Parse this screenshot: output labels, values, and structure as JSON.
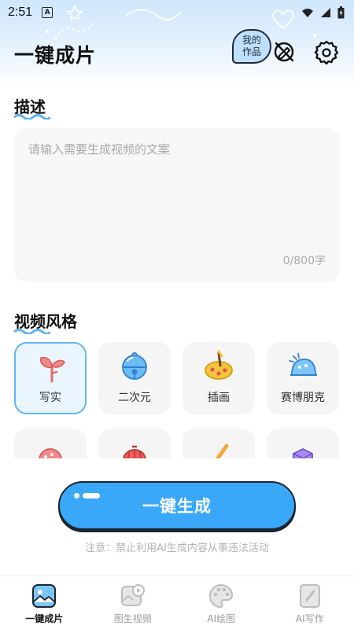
{
  "status_bar": {
    "time": "2:51",
    "notification_letter": "A"
  },
  "header": {
    "title": "一键成片",
    "my_works_line1": "我的",
    "my_works_line2": "作品"
  },
  "description": {
    "section_title": "描述",
    "placeholder": "请输入需要生成视频的文案",
    "value": "",
    "char_count": "0/800字"
  },
  "video_style": {
    "section_title": "视频风格",
    "styles": [
      {
        "label": "写实",
        "icon": "sprout-icon",
        "selected": true
      },
      {
        "label": "二次元",
        "icon": "bell-icon",
        "selected": false
      },
      {
        "label": "插画",
        "icon": "palette-icon",
        "selected": false
      },
      {
        "label": "赛博朋克",
        "icon": "cyber-dome-icon",
        "selected": false
      },
      {
        "label": "",
        "icon": "cookie-icon",
        "selected": false
      },
      {
        "label": "",
        "icon": "lantern-icon",
        "selected": false
      },
      {
        "label": "",
        "icon": "brush-icon",
        "selected": false
      },
      {
        "label": "",
        "icon": "cube-icon",
        "selected": false
      }
    ]
  },
  "generate_button": {
    "label": "一键生成"
  },
  "notice": "注意：禁止利用AI生成内容从事违法活动",
  "tabs": [
    {
      "label": "一键成片",
      "icon": "photo-icon",
      "active": true
    },
    {
      "label": "图生视频",
      "icon": "image-video-icon",
      "active": false
    },
    {
      "label": "AI绘图",
      "icon": "paint-palette-icon",
      "active": false
    },
    {
      "label": "AI写作",
      "icon": "write-icon",
      "active": false
    }
  ],
  "colors": {
    "accent": "#3aa8f8",
    "selected_border": "#62b6f4",
    "outline": "#1c2430"
  }
}
